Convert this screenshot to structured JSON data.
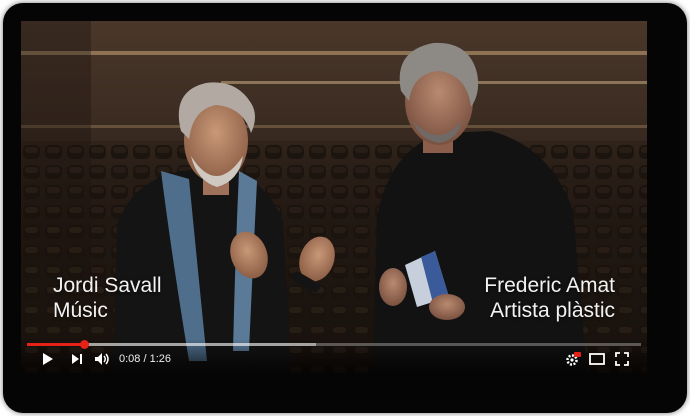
{
  "video": {
    "left_caption": {
      "name": "Jordi Savall",
      "role": "Músic"
    },
    "right_caption": {
      "name": "Frederic Amat",
      "role": "Artista plàstic"
    }
  },
  "controls": {
    "icons": {
      "play": "play-icon",
      "next": "next-icon",
      "volume": "volume-icon",
      "settings": "settings-gear-hd-icon",
      "theater": "theater-mode-icon",
      "fullscreen": "fullscreen-icon"
    },
    "current_time": "0:08",
    "time_separator": " / ",
    "duration": "1:26",
    "progress_fraction": 0.093,
    "buffered_fraction": 0.47
  },
  "colors": {
    "progress": "#e62117",
    "settings_badge": "#e62117",
    "control_icons": "#ffffff"
  }
}
